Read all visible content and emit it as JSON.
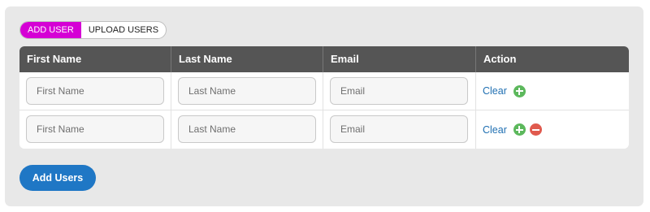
{
  "tabs": [
    {
      "label": "ADD USER",
      "active": true
    },
    {
      "label": "UPLOAD USERS",
      "active": false
    }
  ],
  "table": {
    "columns": [
      "First Name",
      "Last Name",
      "Email",
      "Action"
    ],
    "rows": [
      {
        "first_name": {
          "value": "",
          "placeholder": "First Name"
        },
        "last_name": {
          "value": "",
          "placeholder": "Last Name"
        },
        "email": {
          "value": "",
          "placeholder": "Email"
        },
        "clear_label": "Clear",
        "buttons": [
          "add-icon"
        ]
      },
      {
        "first_name": {
          "value": "",
          "placeholder": "First Name"
        },
        "last_name": {
          "value": "",
          "placeholder": "Last Name"
        },
        "email": {
          "value": "",
          "placeholder": "Email"
        },
        "clear_label": "Clear",
        "buttons": [
          "add-icon",
          "remove-icon"
        ]
      }
    ]
  },
  "submit_label": "Add Users",
  "colors": {
    "active_tab": "#d500d5",
    "header_bg": "#555555",
    "primary_button": "#1f77c5",
    "link": "#1f6fb2",
    "add_icon": "#5cb85c",
    "remove_icon": "#e05a4e"
  }
}
